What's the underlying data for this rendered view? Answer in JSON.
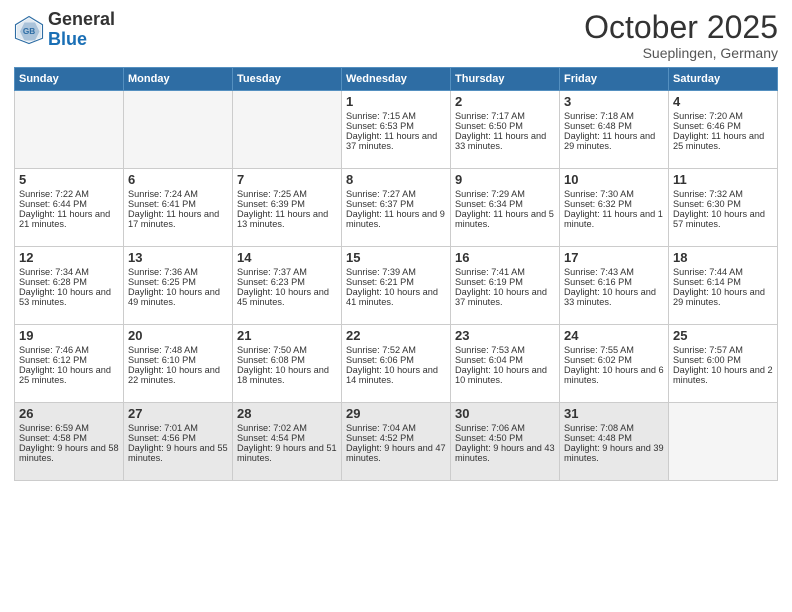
{
  "logo": {
    "general": "General",
    "blue": "Blue"
  },
  "title": "October 2025",
  "location": "Sueplingen, Germany",
  "headers": [
    "Sunday",
    "Monday",
    "Tuesday",
    "Wednesday",
    "Thursday",
    "Friday",
    "Saturday"
  ],
  "weeks": [
    [
      {
        "day": "",
        "info": ""
      },
      {
        "day": "",
        "info": ""
      },
      {
        "day": "",
        "info": ""
      },
      {
        "day": "1",
        "info": "Sunrise: 7:15 AM\nSunset: 6:53 PM\nDaylight: 11 hours and 37 minutes."
      },
      {
        "day": "2",
        "info": "Sunrise: 7:17 AM\nSunset: 6:50 PM\nDaylight: 11 hours and 33 minutes."
      },
      {
        "day": "3",
        "info": "Sunrise: 7:18 AM\nSunset: 6:48 PM\nDaylight: 11 hours and 29 minutes."
      },
      {
        "day": "4",
        "info": "Sunrise: 7:20 AM\nSunset: 6:46 PM\nDaylight: 11 hours and 25 minutes."
      }
    ],
    [
      {
        "day": "5",
        "info": "Sunrise: 7:22 AM\nSunset: 6:44 PM\nDaylight: 11 hours and 21 minutes."
      },
      {
        "day": "6",
        "info": "Sunrise: 7:24 AM\nSunset: 6:41 PM\nDaylight: 11 hours and 17 minutes."
      },
      {
        "day": "7",
        "info": "Sunrise: 7:25 AM\nSunset: 6:39 PM\nDaylight: 11 hours and 13 minutes."
      },
      {
        "day": "8",
        "info": "Sunrise: 7:27 AM\nSunset: 6:37 PM\nDaylight: 11 hours and 9 minutes."
      },
      {
        "day": "9",
        "info": "Sunrise: 7:29 AM\nSunset: 6:34 PM\nDaylight: 11 hours and 5 minutes."
      },
      {
        "day": "10",
        "info": "Sunrise: 7:30 AM\nSunset: 6:32 PM\nDaylight: 11 hours and 1 minute."
      },
      {
        "day": "11",
        "info": "Sunrise: 7:32 AM\nSunset: 6:30 PM\nDaylight: 10 hours and 57 minutes."
      }
    ],
    [
      {
        "day": "12",
        "info": "Sunrise: 7:34 AM\nSunset: 6:28 PM\nDaylight: 10 hours and 53 minutes."
      },
      {
        "day": "13",
        "info": "Sunrise: 7:36 AM\nSunset: 6:25 PM\nDaylight: 10 hours and 49 minutes."
      },
      {
        "day": "14",
        "info": "Sunrise: 7:37 AM\nSunset: 6:23 PM\nDaylight: 10 hours and 45 minutes."
      },
      {
        "day": "15",
        "info": "Sunrise: 7:39 AM\nSunset: 6:21 PM\nDaylight: 10 hours and 41 minutes."
      },
      {
        "day": "16",
        "info": "Sunrise: 7:41 AM\nSunset: 6:19 PM\nDaylight: 10 hours and 37 minutes."
      },
      {
        "day": "17",
        "info": "Sunrise: 7:43 AM\nSunset: 6:16 PM\nDaylight: 10 hours and 33 minutes."
      },
      {
        "day": "18",
        "info": "Sunrise: 7:44 AM\nSunset: 6:14 PM\nDaylight: 10 hours and 29 minutes."
      }
    ],
    [
      {
        "day": "19",
        "info": "Sunrise: 7:46 AM\nSunset: 6:12 PM\nDaylight: 10 hours and 25 minutes."
      },
      {
        "day": "20",
        "info": "Sunrise: 7:48 AM\nSunset: 6:10 PM\nDaylight: 10 hours and 22 minutes."
      },
      {
        "day": "21",
        "info": "Sunrise: 7:50 AM\nSunset: 6:08 PM\nDaylight: 10 hours and 18 minutes."
      },
      {
        "day": "22",
        "info": "Sunrise: 7:52 AM\nSunset: 6:06 PM\nDaylight: 10 hours and 14 minutes."
      },
      {
        "day": "23",
        "info": "Sunrise: 7:53 AM\nSunset: 6:04 PM\nDaylight: 10 hours and 10 minutes."
      },
      {
        "day": "24",
        "info": "Sunrise: 7:55 AM\nSunset: 6:02 PM\nDaylight: 10 hours and 6 minutes."
      },
      {
        "day": "25",
        "info": "Sunrise: 7:57 AM\nSunset: 6:00 PM\nDaylight: 10 hours and 2 minutes."
      }
    ],
    [
      {
        "day": "26",
        "info": "Sunrise: 6:59 AM\nSunset: 4:58 PM\nDaylight: 9 hours and 58 minutes."
      },
      {
        "day": "27",
        "info": "Sunrise: 7:01 AM\nSunset: 4:56 PM\nDaylight: 9 hours and 55 minutes."
      },
      {
        "day": "28",
        "info": "Sunrise: 7:02 AM\nSunset: 4:54 PM\nDaylight: 9 hours and 51 minutes."
      },
      {
        "day": "29",
        "info": "Sunrise: 7:04 AM\nSunset: 4:52 PM\nDaylight: 9 hours and 47 minutes."
      },
      {
        "day": "30",
        "info": "Sunrise: 7:06 AM\nSunset: 4:50 PM\nDaylight: 9 hours and 43 minutes."
      },
      {
        "day": "31",
        "info": "Sunrise: 7:08 AM\nSunset: 4:48 PM\nDaylight: 9 hours and 39 minutes."
      },
      {
        "day": "",
        "info": ""
      }
    ]
  ]
}
